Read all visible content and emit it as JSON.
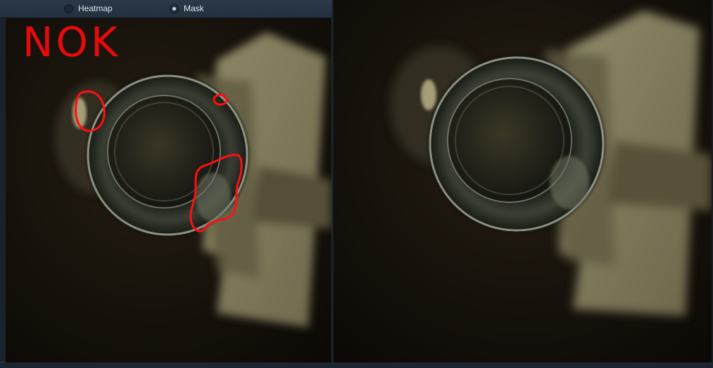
{
  "toolbar": {
    "options": [
      {
        "label": "Heatmap",
        "selected": false
      },
      {
        "label": "Mask",
        "selected": true
      }
    ]
  },
  "result": {
    "status_text": "NOK",
    "status_color": "#e50b0b"
  },
  "views": {
    "left": {
      "content": "camera-image-with-defect-mask"
    },
    "right": {
      "content": "original-camera-image"
    }
  },
  "colors": {
    "mask_outline": "#ff1010",
    "background": "#141c25",
    "toolbar": "#2a3847"
  }
}
